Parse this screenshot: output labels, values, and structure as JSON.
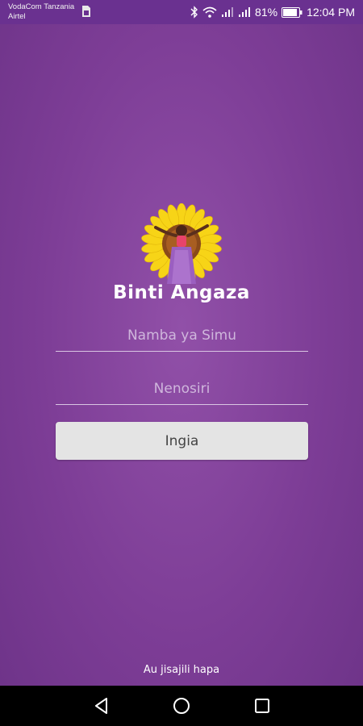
{
  "status_bar": {
    "carrier_1": "VodaCom Tanzania",
    "carrier_2": "Airtel",
    "battery": "81%",
    "time": "12:04 PM"
  },
  "app": {
    "title": "Binti Angaza"
  },
  "form": {
    "phone_placeholder": "Namba ya Simu",
    "password_placeholder": "Nenosiri",
    "login_label": "Ingia",
    "register_label": "Au jisajili hapa"
  },
  "nav": {
    "icons": [
      "back-icon",
      "home-icon",
      "recents-icon"
    ]
  },
  "colors": {
    "background": "#7d3d96",
    "status_bar": "#6a3190",
    "button": "#e4e4e4",
    "sunflower": "#f7d417"
  }
}
